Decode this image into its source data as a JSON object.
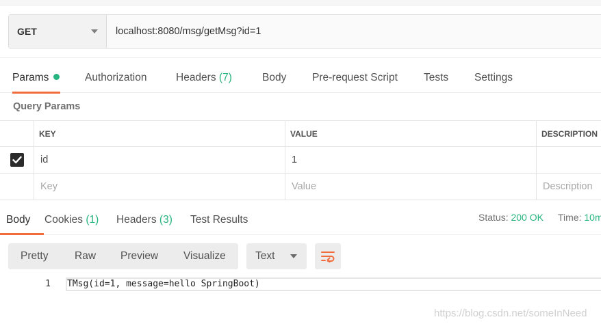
{
  "request": {
    "method": "GET",
    "url": "localhost:8080/msg/getMsg?id=1"
  },
  "request_tabs": [
    {
      "label": "Params",
      "active": true,
      "dot": true
    },
    {
      "label": "Authorization"
    },
    {
      "label": "Headers",
      "count": "(7)"
    },
    {
      "label": "Body"
    },
    {
      "label": "Pre-request Script"
    },
    {
      "label": "Tests"
    },
    {
      "label": "Settings"
    }
  ],
  "query_params": {
    "title": "Query Params",
    "columns": [
      "KEY",
      "VALUE",
      "DESCRIPTION"
    ],
    "rows": [
      {
        "checked": true,
        "key": "id",
        "value": "1",
        "description": ""
      }
    ],
    "placeholders": {
      "key": "Key",
      "value": "Value",
      "description": "Description"
    }
  },
  "response_tabs": [
    {
      "label": "Body",
      "active": true
    },
    {
      "label": "Cookies",
      "count": "(1)"
    },
    {
      "label": "Headers",
      "count": "(3)"
    },
    {
      "label": "Test Results"
    }
  ],
  "response_meta": {
    "status_label": "Status:",
    "status_value": "200 OK",
    "time_label": "Time:",
    "time_value": "10m"
  },
  "view_modes": [
    "Pretty",
    "Raw",
    "Preview",
    "Visualize"
  ],
  "format": "Text",
  "response_body": {
    "line_number": "1",
    "content": "TMsg(id=1, message=hello SpringBoot)"
  },
  "watermark": "https://blog.csdn.net/someInNeed",
  "colors": {
    "accent_orange": "#f26b3a",
    "accent_green": "#26b47f"
  }
}
